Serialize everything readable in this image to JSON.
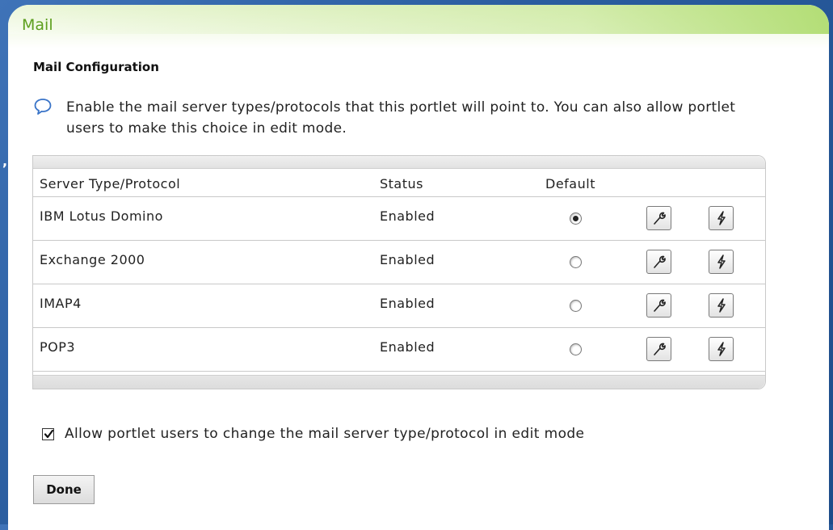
{
  "portlet": {
    "title": "Mail"
  },
  "section_title": "Mail Configuration",
  "help": {
    "icon": "speech-bubble-icon",
    "text": "Enable the mail server types/protocols that this portlet will point to. You can also allow portlet users to make this choice in edit mode."
  },
  "table": {
    "headers": {
      "server": "Server Type/Protocol",
      "status": "Status",
      "default": "Default"
    },
    "rows": [
      {
        "server": "IBM Lotus Domino",
        "status": "Enabled",
        "default": true
      },
      {
        "server": "Exchange 2000",
        "status": "Enabled",
        "default": false
      },
      {
        "server": "IMAP4",
        "status": "Enabled",
        "default": false
      },
      {
        "server": "POP3",
        "status": "Enabled",
        "default": false
      }
    ],
    "row_icons": [
      "wrench-icon",
      "lightning-icon"
    ]
  },
  "allow_edit": {
    "checked": true,
    "label": "Allow portlet users to change the mail server type/protocol in edit mode"
  },
  "done_label": "Done"
}
